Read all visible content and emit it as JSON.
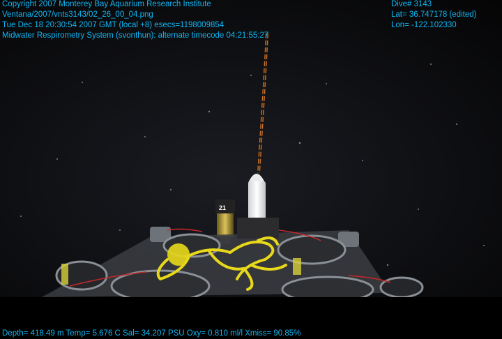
{
  "overlay": {
    "header_left": [
      "Copyright 2007 Monterey Bay Aquarium Research Institute",
      "Ventana/2007/vnts3143/02_26_00_04.png",
      "Tue Dec 18 20:30:54 2007 GMT (local +8)  esecs=1198009854",
      "Midwater Respirometry System (svonthun): alternate timecode 04:21:55:27"
    ],
    "header_right": [
      "Dive# 3143",
      "Lat= 36.747178 (edited)",
      "Lon= -122.102330"
    ],
    "footer": "Depth= 418.49 m  Temp= 5.676 C  Sal= 34.207 PSU  Oxy= 0.810 ml/l  Xmiss= 90.85%"
  },
  "scene": {
    "label_on_housing": "21",
    "colors": {
      "overlay_text": "#11b6f2",
      "background": "#000000",
      "yellow_rope": "#e8d81a",
      "tether": "#c8702a",
      "chamber_ring": "#8a9096"
    }
  }
}
